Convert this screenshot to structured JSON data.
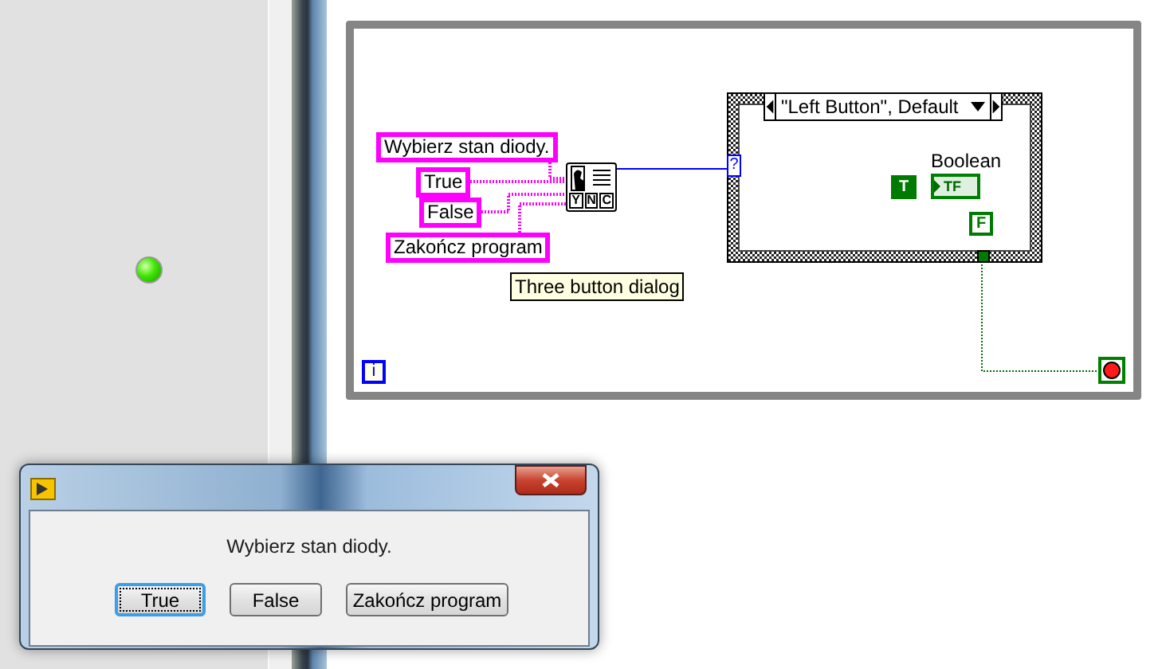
{
  "front_panel": {
    "led": {
      "on": true
    }
  },
  "block_diagram": {
    "string_constants": [
      {
        "text": "Wybierz stan diody."
      },
      {
        "text": "True"
      },
      {
        "text": "False"
      },
      {
        "text": "Zakończ program"
      }
    ],
    "function": {
      "icon_letters": [
        "Y",
        "N",
        "C"
      ],
      "tooltip": "Three button dialog"
    },
    "case_structure": {
      "selector": "\"Left Button\", Default",
      "selector_terminal": "?",
      "true_constant": "T",
      "indicator": {
        "label": "Boolean",
        "text": "TF"
      },
      "false_constant": "F"
    },
    "loop_iteration": "i",
    "stop_terminal": {
      "on": true
    }
  },
  "dialog": {
    "message": "Wybierz stan diody.",
    "buttons": [
      {
        "label": "True",
        "selected": true
      },
      {
        "label": "False",
        "selected": false
      },
      {
        "label": "Zakończ program",
        "selected": false
      }
    ]
  }
}
